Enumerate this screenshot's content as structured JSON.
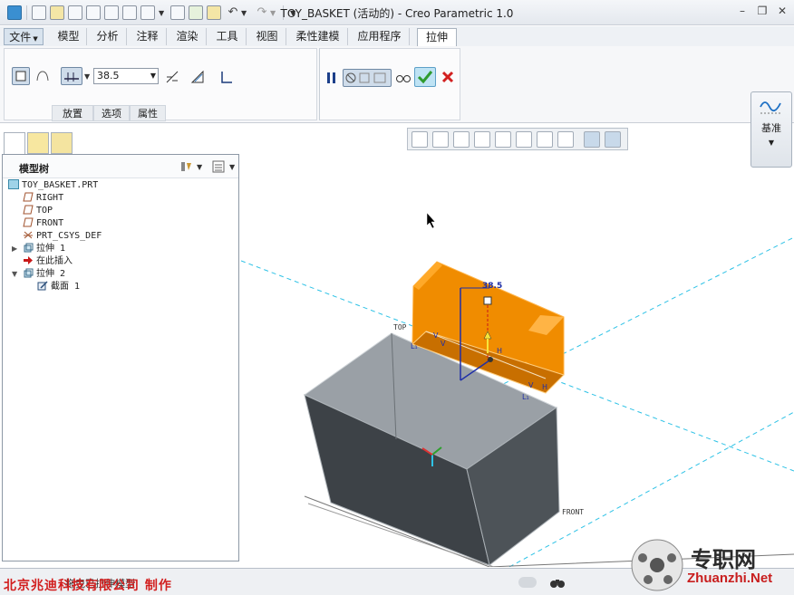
{
  "window": {
    "title": "TOY_BASKET (活动的) - Creo Parametric 1.0"
  },
  "tabs": [
    {
      "label": "文件",
      "active": false
    },
    {
      "label": "模型",
      "active": false
    },
    {
      "label": "分析",
      "active": false
    },
    {
      "label": "注释",
      "active": false
    },
    {
      "label": "渲染",
      "active": false
    },
    {
      "label": "工具",
      "active": false
    },
    {
      "label": "视图",
      "active": false
    },
    {
      "label": "柔性建模",
      "active": false
    },
    {
      "label": "应用程序",
      "active": false
    },
    {
      "label": "拉伸",
      "active": true
    }
  ],
  "ribbon": {
    "depth_value": "38.5",
    "subtabs": [
      "放置",
      "选项",
      "属性"
    ],
    "datum_label": "基准"
  },
  "model_tree": {
    "title": "模型树",
    "items": [
      {
        "label": "TOY_BASKET.PRT",
        "icon": "part-icon"
      },
      {
        "label": "RIGHT",
        "icon": "datum-plane-icon"
      },
      {
        "label": "TOP",
        "icon": "datum-plane-icon"
      },
      {
        "label": "FRONT",
        "icon": "datum-plane-icon"
      },
      {
        "label": "PRT_CSYS_DEF",
        "icon": "csys-icon"
      },
      {
        "label": "拉伸 1",
        "icon": "extrude-icon"
      },
      {
        "label": "在此插入",
        "icon": "insert-arrow-icon"
      },
      {
        "label": "拉伸 2",
        "icon": "extrude-icon"
      },
      {
        "label": "截面 1",
        "icon": "sketch-icon"
      }
    ]
  },
  "graphics": {
    "dimension_label": "38.5",
    "plane_label_top": "TOP",
    "plane_label_front": "FRONT"
  },
  "status": {
    "message": "拖曳已拉伸模型"
  },
  "watermark": {
    "left_text": "北京兆迪科技有限公司   制作",
    "right_text_1": "专职网",
    "right_text_2": "Zhuanzhi.Net"
  },
  "colors": {
    "extrude_preview": "#f08c00",
    "solid_gray": "#7f868d",
    "accept_green": "#2f9b2f",
    "cancel_red": "#d22020",
    "plane_cyan": "#2ec2e6"
  }
}
